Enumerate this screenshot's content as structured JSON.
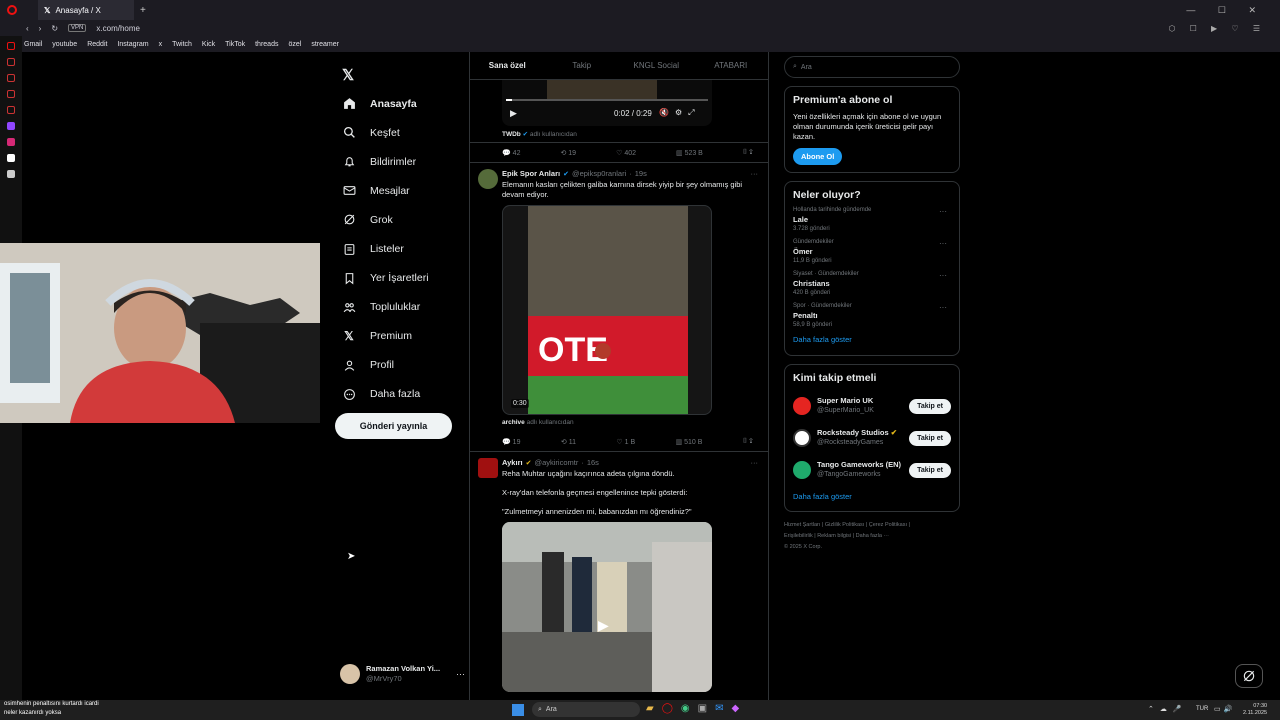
{
  "browser": {
    "tab_title": "Anasayfa / X",
    "url": "x.com/home",
    "bookmarks": [
      "Gmail",
      "youtube",
      "Reddit",
      "Instagram",
      "x",
      "Twitch",
      "Kick",
      "TikTok",
      "threads",
      "özel",
      "streamer"
    ]
  },
  "nav": {
    "items": [
      {
        "label": "Anasayfa",
        "icon": "home-icon",
        "active": true
      },
      {
        "label": "Keşfet",
        "icon": "search-icon"
      },
      {
        "label": "Bildirimler",
        "icon": "bell-icon"
      },
      {
        "label": "Mesajlar",
        "icon": "mail-icon"
      },
      {
        "label": "Grok",
        "icon": "grok-icon"
      },
      {
        "label": "Listeler",
        "icon": "list-icon"
      },
      {
        "label": "Yer İşaretleri",
        "icon": "bookmark-icon"
      },
      {
        "label": "Topluluklar",
        "icon": "people-icon"
      },
      {
        "label": "Premium",
        "icon": "x-logo-icon"
      },
      {
        "label": "Profil",
        "icon": "person-icon"
      },
      {
        "label": "Daha fazla",
        "icon": "more-circle-icon"
      }
    ],
    "post_button": "Gönderi yayınla",
    "user_name": "Ramazan Volkan Yi...",
    "user_handle": "@MrVry70"
  },
  "timeline": {
    "tabs": [
      "Sana özel",
      "Takip",
      "KNGL Social",
      "ATABARI"
    ],
    "video_time": "0:02 / 0:29",
    "post0": {
      "source": "TWDb",
      "source_note": "adlı kullanıcıdan",
      "replies": "42",
      "reposts": "19",
      "likes": "402",
      "views": "523 B"
    },
    "post1": {
      "name": "Epik Spor Anları",
      "handle": "@epiksp0ranlari",
      "time": "19s",
      "text": "Elemanın kasları çelikten galiba karnına dirsek yiyip bir şey olmamış gibi devam ediyor.",
      "duration": "0:30",
      "source": "archive",
      "source_note": "adlı kullanıcıdan",
      "replies": "19",
      "reposts": "11",
      "likes": "1 B",
      "views": "510 B"
    },
    "post2": {
      "name": "Aykırı",
      "handle": "@aykiricomtr",
      "time": "16s",
      "line1": "Reha Muhtar uçağını kaçırınca adeta çılgına döndü.",
      "line2": "X-ray'dan telefonla geçmesi engellenince tepki gösterdi:",
      "line3": "\"Zulmetmeyi annenizden mi, babanızdan mı öğrendiniz?\""
    }
  },
  "right": {
    "search_placeholder": "Ara",
    "premium": {
      "title": "Premium'a abone ol",
      "body": "Yeni özellikleri açmak için abone ol ve uygun olman durumunda içerik üreticisi gelir payı kazan.",
      "button": "Abone Ol"
    },
    "trends_title": "Neler oluyor?",
    "trends": [
      {
        "context": "Hollanda tarihinde gündemde",
        "name": "Lale",
        "count": "3.728 gönderi"
      },
      {
        "context": "Gündemdekiler",
        "name": "Ömer",
        "count": "11,9 B gönderi"
      },
      {
        "context": "Siyaset · Gündemdekiler",
        "name": "Christians",
        "count": "420 B gönderi"
      },
      {
        "context": "Spor · Gündemdekiler",
        "name": "Penaltı",
        "count": "58,9 B gönderi"
      }
    ],
    "show_more": "Daha fazla göster",
    "who_title": "Kimi takip etmeli",
    "who": [
      {
        "name": "Super Mario UK",
        "handle": "@SuperMario_UK",
        "button": "Takip et",
        "color": "#e52521"
      },
      {
        "name": "Rocksteady Studios",
        "handle": "@RocksteadyGames",
        "button": "Takip et",
        "color": "#ffffff"
      },
      {
        "name": "Tango Gameworks (EN)",
        "handle": "@TangoGameworks",
        "button": "Takip et",
        "color": "#1faa6c"
      }
    ],
    "footer1": "Hizmet Şartları | Gizlilik Politikası | Çerez Politikası |",
    "footer2": "Erişilebilirlik | Reklam bilgisi | Daha fazla ···",
    "footer3": "© 2025 X Corp."
  },
  "overlay": {
    "chat1": "osimhenin penaltısını kurtardı icardi",
    "chat2": "neler kazanırdı yoksa"
  },
  "taskbar": {
    "search": "Ara",
    "lang": "TUR",
    "time": "07:30",
    "date": "2.11.2025"
  }
}
